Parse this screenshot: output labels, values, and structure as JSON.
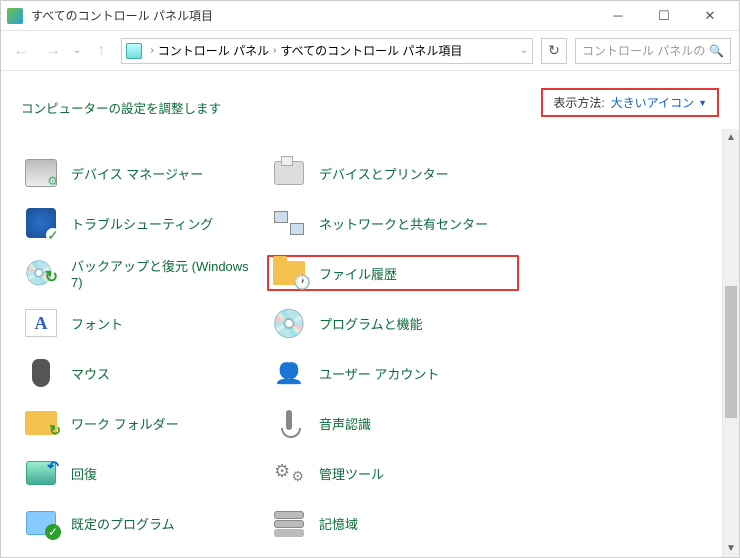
{
  "window": {
    "title": "すべてのコントロール パネル項目"
  },
  "breadcrumb": {
    "item1": "コントロール パネル",
    "item2": "すべてのコントロール パネル項目",
    "dropdown_glyph": "⌄"
  },
  "search": {
    "placeholder": "コントロール パネルの検索"
  },
  "header": {
    "subtitle": "コンピューターの設定を調整します",
    "view_label": "表示方法:",
    "view_value": "大きいアイコン"
  },
  "col1": {
    "i0": "デバイス マネージャー",
    "i1": "トラブルシューティング",
    "i2": "バックアップと復元 (Windows 7)",
    "i3": "フォント",
    "i4": "マウス",
    "i5": "ワーク フォルダー",
    "i6": "回復",
    "i7": "既定のプログラム",
    "font_glyph": "A"
  },
  "col2": {
    "i0": "デバイスとプリンター",
    "i1": "ネットワークと共有センター",
    "i2": "ファイル履歴",
    "i3": "プログラムと機能",
    "i4": "ユーザー アカウント",
    "i5": "音声認識",
    "i6": "管理ツール",
    "i7": "記憶域"
  }
}
